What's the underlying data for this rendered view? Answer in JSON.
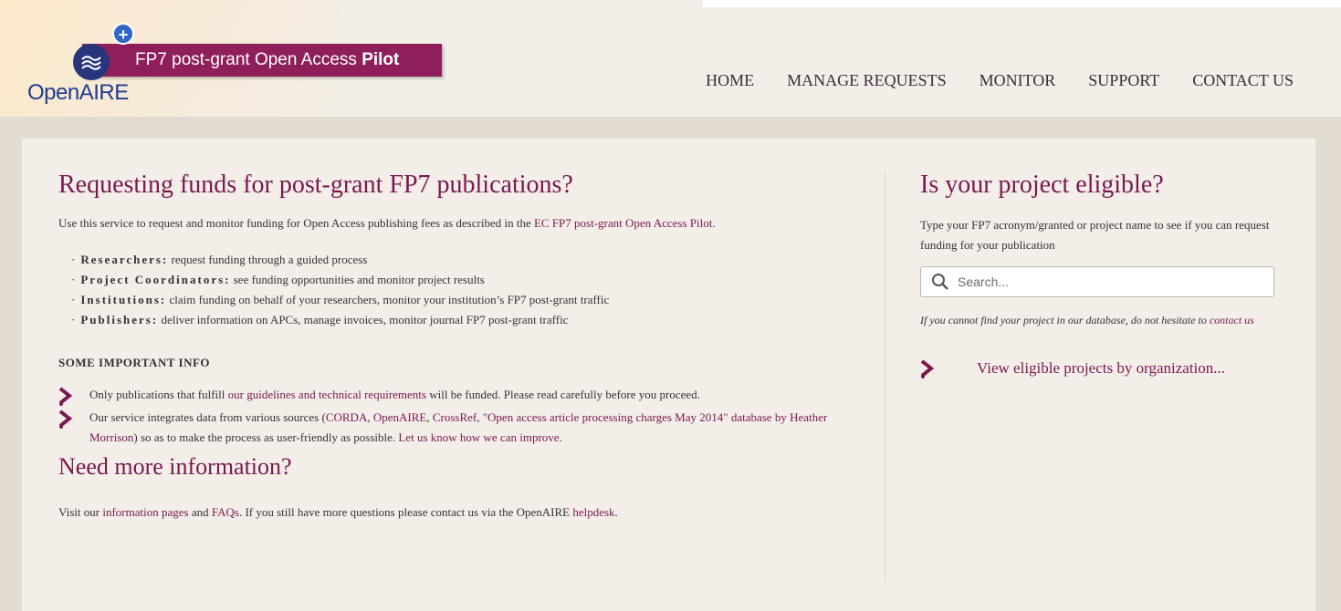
{
  "header": {
    "banner_prefix": "FP7 post-grant Open Access ",
    "banner_bold": "Pilot",
    "logo_text": "OpenAIRE",
    "plus_symbol": "+",
    "nav": [
      "HOME",
      "MANAGE REQUESTS",
      "MONITOR",
      "SUPPORT",
      "CONTACT US"
    ]
  },
  "main": {
    "title": "Requesting funds for post-grant FP7 publications?",
    "intro_text": "Use this service to request and monitor funding for Open Access publishing fees as described in the ",
    "intro_link": "EC FP7 post-grant Open Access Pilot",
    "intro_end": ".",
    "roles": [
      {
        "role": "Researchers:",
        "desc": "request funding through a guided process"
      },
      {
        "role": "Project Coordinators:",
        "desc": "see funding opportunities and monitor project results"
      },
      {
        "role": "Institutions:",
        "desc": "claim funding on behalf of your researchers, monitor your institution’s FP7 post-grant traffic"
      },
      {
        "role": "Publishers:",
        "desc": "deliver information on APCs, manage invoices, monitor journal FP7 post-grant traffic"
      }
    ],
    "info_title": "SOME IMPORTANT INFO",
    "info1_a": "Only publications that fulfill ",
    "info1_link": "our guidelines and technical requirements",
    "info1_b": " will be funded. Please read carefully before you proceed.",
    "info2_a": "Our service integrates data from various sources (",
    "info2_link1": "CORDA",
    "info2_sep1": ", ",
    "info2_link2": "OpenAIRE",
    "info2_sep2": ", ",
    "info2_link3": "CrossRef",
    "info2_sep3": ", ",
    "info2_link4": "\"Open access article processing charges May 2014\" database by Heather Morrison",
    "info2_b": ") so as to make the process as user-friendly as possible. ",
    "info2_link5": "Let us know how we can improve",
    "info2_end": ".",
    "need_title": "Need more information?",
    "footer_a": "Visit our ",
    "footer_link1": "information pages",
    "footer_b": " and ",
    "footer_link2": "FAQs",
    "footer_c": ". If you still have more questions please contact us via the OpenAIRE ",
    "footer_link3": "helpdesk",
    "footer_end": "."
  },
  "sidebar": {
    "title": "Is your project eligible?",
    "intro": "Type your FP7 acronym/granted or project name to see if you can request funding for your publication",
    "search_placeholder": "Search...",
    "note_a": "If you cannot find your project in our database, do not hesitate to ",
    "note_link": "contact us",
    "view_link": "View eligible projects by organization..."
  },
  "colors": {
    "accent": "#7a1850",
    "banner": "#8e1f5b",
    "logo_blue": "#1f3d8f",
    "background": "#f3efe8"
  },
  "icons": {
    "search": "search-icon",
    "chevron": "chevron-right-icon",
    "logo": "openaire-wave-icon"
  }
}
